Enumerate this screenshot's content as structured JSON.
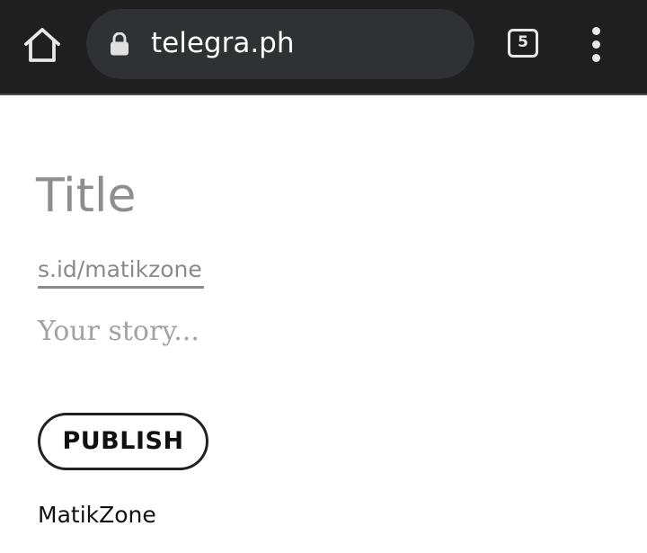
{
  "browser": {
    "url": "telegra.ph",
    "tab_count": "5",
    "home_icon": "home-icon",
    "lock_icon": "lock-icon",
    "menu_icon": "more-vert-icon"
  },
  "editor": {
    "title_placeholder": "Title",
    "author_value": "s.id/matikzone",
    "story_placeholder": "Your story...",
    "publish_label": "PUBLISH",
    "author_name": "MatikZone"
  }
}
